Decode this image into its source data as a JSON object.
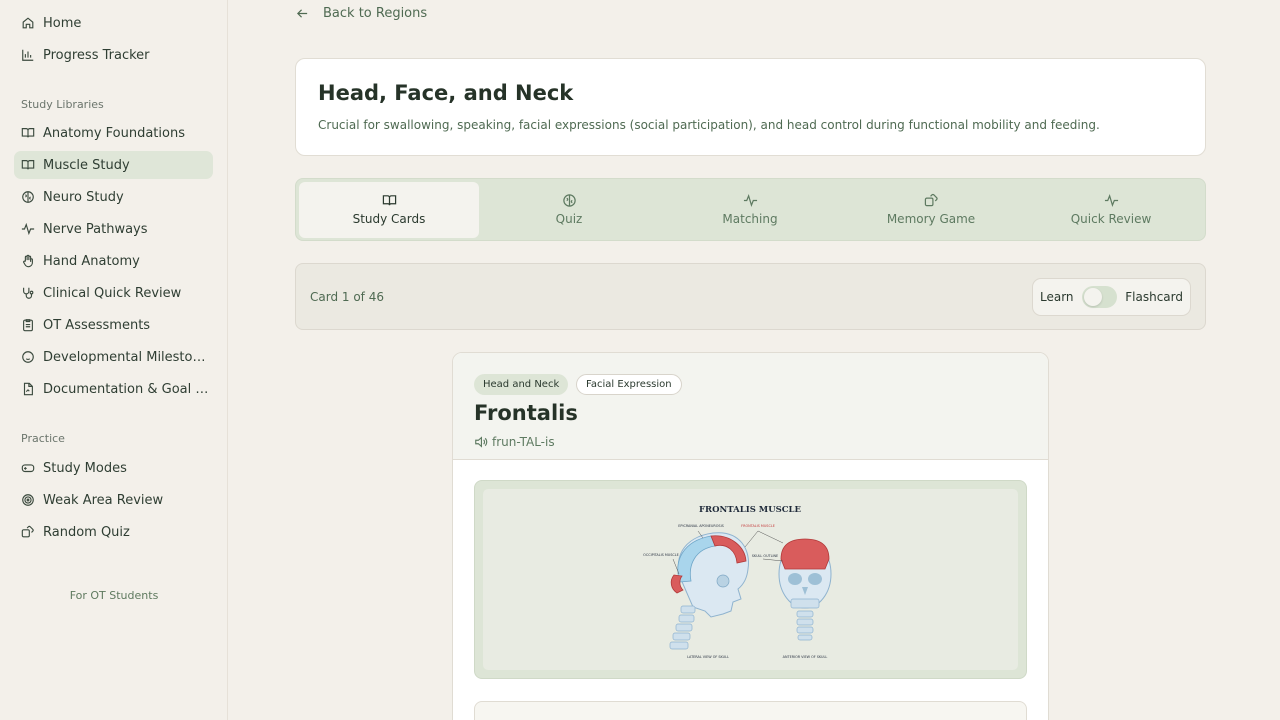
{
  "sidebar": {
    "top_items": [
      {
        "label": "Home",
        "icon": "home-icon"
      },
      {
        "label": "Progress Tracker",
        "icon": "bar-chart-icon"
      }
    ],
    "study_label": "Study Libraries",
    "study_items": [
      {
        "label": "Anatomy Foundations",
        "icon": "book-icon"
      },
      {
        "label": "Muscle Study",
        "icon": "book-icon",
        "active": true
      },
      {
        "label": "Neuro Study",
        "icon": "brain-icon"
      },
      {
        "label": "Nerve Pathways",
        "icon": "pulse-icon"
      },
      {
        "label": "Hand Anatomy",
        "icon": "hand-icon"
      },
      {
        "label": "Clinical Quick Review",
        "icon": "stethoscope-icon"
      },
      {
        "label": "OT Assessments",
        "icon": "clipboard-icon"
      },
      {
        "label": "Developmental Milestones",
        "icon": "baby-icon"
      },
      {
        "label": "Documentation & Goal Writ...",
        "icon": "document-icon"
      }
    ],
    "practice_label": "Practice",
    "practice_items": [
      {
        "label": "Study Modes",
        "icon": "gamepad-icon"
      },
      {
        "label": "Weak Area Review",
        "icon": "target-icon"
      },
      {
        "label": "Random Quiz",
        "icon": "dice-icon"
      }
    ],
    "footer": "For OT Students"
  },
  "main": {
    "back_label": "Back to Regions",
    "region_title": "Head, Face, and Neck",
    "region_description": "Crucial for swallowing, speaking, facial expressions (social participation), and head control during functional mobility and feeding.",
    "tabs": [
      {
        "label": "Study Cards",
        "icon": "book-icon",
        "active": true
      },
      {
        "label": "Quiz",
        "icon": "brain-icon"
      },
      {
        "label": "Matching",
        "icon": "pulse-icon"
      },
      {
        "label": "Memory Game",
        "icon": "dice-icon"
      },
      {
        "label": "Quick Review",
        "icon": "pulse-icon"
      }
    ],
    "card_counter": "Card 1 of 46",
    "mode_learn": "Learn",
    "mode_flashcard": "Flashcard",
    "mode_flashcard_on": false
  },
  "card": {
    "tags": [
      "Head and Neck",
      "Facial Expression"
    ],
    "title": "Frontalis",
    "pronunciation": "frun-TAL-is",
    "illustration": {
      "title": "FRONTALIS MUSCLE",
      "labels": [
        "EPICRANIAL APONEUROSIS",
        "FRONTALIS MUSCLE",
        "OCCIPITALIS MUSCLE",
        "SKULL OUTLINE",
        "LATERAL VIEW OF SKULL",
        "ANTERIOR VIEW OF SKULL"
      ]
    }
  },
  "colors": {
    "accent": "#4f6a52",
    "active_bg": "#dfe6d8",
    "muscle_red": "#d9534f",
    "bone_blue": "#bcd6e6"
  }
}
